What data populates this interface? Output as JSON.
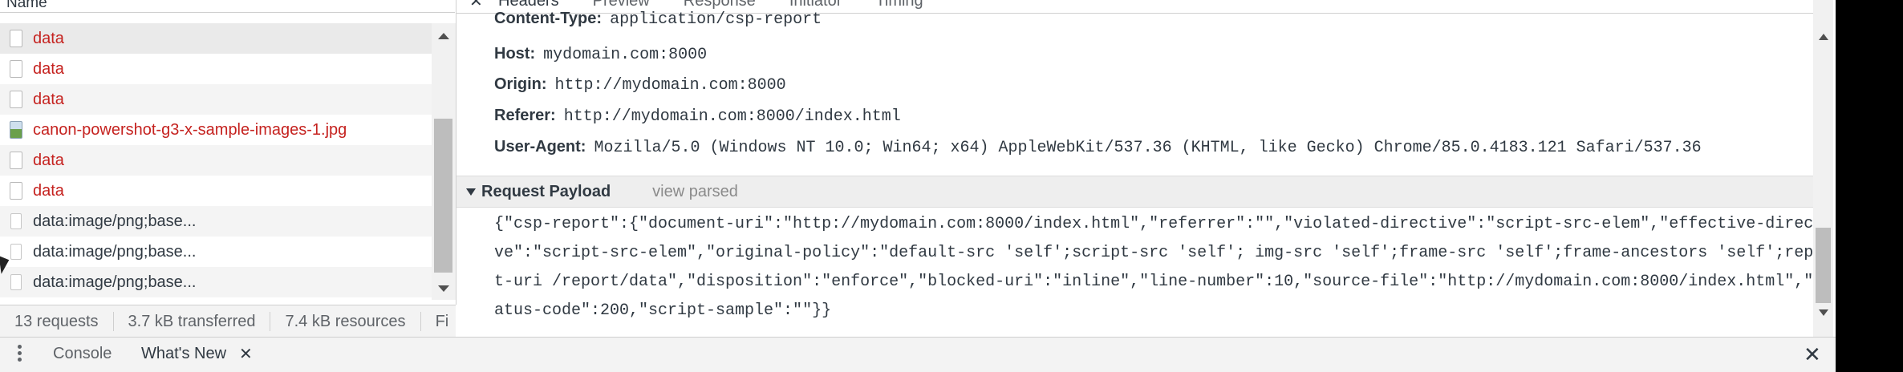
{
  "left": {
    "header": "Name",
    "requests": [
      {
        "name": "data",
        "icon": "document-icon",
        "color": "red"
      },
      {
        "name": "data",
        "icon": "document-icon",
        "color": "red"
      },
      {
        "name": "data",
        "icon": "document-icon",
        "color": "red"
      },
      {
        "name": "canon-powershot-g3-x-sample-images-1.jpg",
        "icon": "image-icon",
        "color": "red"
      },
      {
        "name": "data",
        "icon": "document-icon",
        "color": "red"
      },
      {
        "name": "data",
        "icon": "document-icon",
        "color": "red"
      },
      {
        "name": "data:image/png;base...",
        "icon": "image-file-icon",
        "color": "normal"
      },
      {
        "name": "data:image/png;base...",
        "icon": "image-file-icon",
        "color": "normal"
      },
      {
        "name": "data:image/png;base...",
        "icon": "image-file-icon",
        "color": "normal"
      }
    ],
    "status": {
      "requests": "13 requests",
      "transferred": "3.7 kB transferred",
      "resources": "7.4 kB resources",
      "finish": "Fi"
    }
  },
  "detail": {
    "tabs": [
      "Headers",
      "Preview",
      "Response",
      "Initiator",
      "Timing"
    ],
    "active_tab": "Headers",
    "headers": [
      {
        "name": "Content-Type:",
        "value": "application/csp-report"
      },
      {
        "name": "Host:",
        "value": "mydomain.com:8000"
      },
      {
        "name": "Origin:",
        "value": "http://mydomain.com:8000"
      },
      {
        "name": "Referer:",
        "value": "http://mydomain.com:8000/index.html"
      },
      {
        "name": "User-Agent:",
        "value": "Mozilla/5.0 (Windows NT 10.0; Win64; x64) AppleWebKit/537.36 (KHTML, like Gecko) Chrome/85.0.4183.121 Safari/537.36"
      }
    ],
    "payload": {
      "title": "Request Payload",
      "view_parsed": "view parsed",
      "lines": [
        "{\"csp-report\":{\"document-uri\":\"http://mydomain.com:8000/index.html\",\"referrer\":\"\",\"violated-directive\":\"script-src-elem\",\"effective-directi",
        "ve\":\"script-src-elem\",\"original-policy\":\"default-src 'self';script-src 'self'; img-src 'self';frame-src 'self';frame-ancestors 'self';repor",
        "t-uri /report/data\",\"disposition\":\"enforce\",\"blocked-uri\":\"inline\",\"line-number\":10,\"source-file\":\"http://mydomain.com:8000/index.html\",\"st",
        "atus-code\":200,\"script-sample\":\"\"}}"
      ]
    }
  },
  "drawer": {
    "console": "Console",
    "whats_new": "What's New",
    "close_glyph": "✕"
  },
  "colors": {
    "red_request": "#c5221f",
    "panel_bg": "#f3f3f3",
    "edge": "#000000"
  }
}
